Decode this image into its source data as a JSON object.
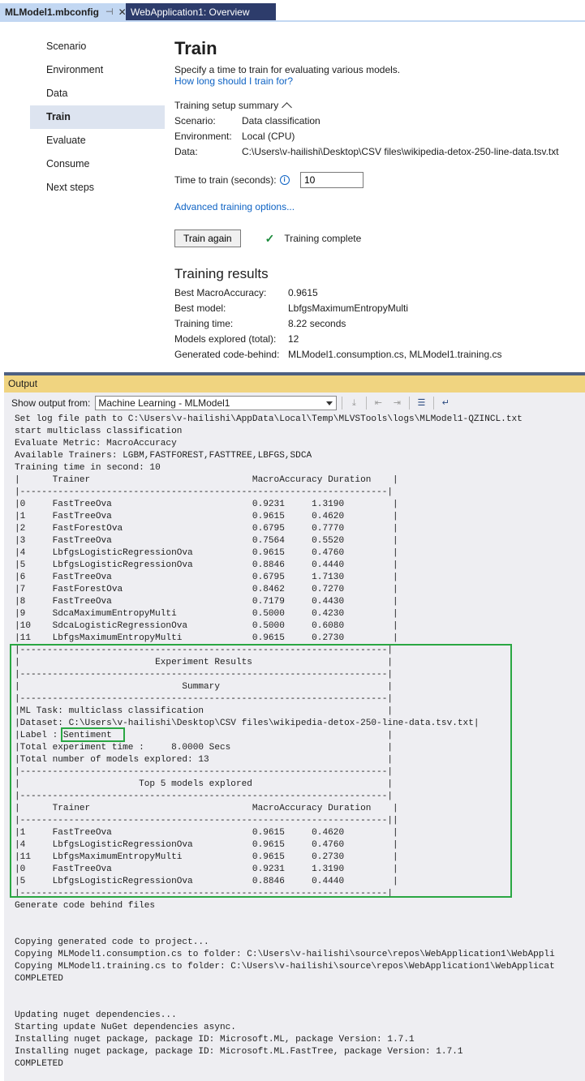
{
  "tabs": {
    "active_label": "MLModel1.mbconfig",
    "active_pin": "⊣",
    "active_close": "✕",
    "inactive_label": "WebApplication1: Overview"
  },
  "nav": {
    "items": [
      "Scenario",
      "Environment",
      "Data",
      "Train",
      "Evaluate",
      "Consume",
      "Next steps"
    ],
    "active": "Train"
  },
  "train": {
    "title": "Train",
    "description": "Specify a time to train for evaluating various models.",
    "help_link": "How long should I train for?",
    "summary_toggle": "Training setup summary",
    "summary": [
      {
        "key": "Scenario:",
        "value": "Data classification"
      },
      {
        "key": "Environment:",
        "value": "Local (CPU)"
      },
      {
        "key": "Data:",
        "value": "C:\\Users\\v-hailishi\\Desktop\\CSV files\\wikipedia-detox-250-line-data.tsv.txt"
      }
    ],
    "time_label": "Time to train (seconds):",
    "time_value": "10",
    "advanced_link": "Advanced training options...",
    "train_button": "Train again",
    "status": "Training complete"
  },
  "results": {
    "title": "Training results",
    "rows": [
      {
        "key": "Best MacroAccuracy:",
        "value": "0.9615"
      },
      {
        "key": "Best model:",
        "value": "LbfgsMaximumEntropyMulti"
      },
      {
        "key": "Training time:",
        "value": "8.22 seconds"
      },
      {
        "key": "Models explored (total):",
        "value": "12"
      },
      {
        "key": "Generated code-behind:",
        "value": "MLModel1.consumption.cs, MLModel1.training.cs"
      }
    ]
  },
  "output": {
    "header": "Output",
    "show_from_label": "Show output from:",
    "source": "Machine Learning - MLModel1",
    "log": [
      "Set log file path to C:\\Users\\v-hailishi\\AppData\\Local\\Temp\\MLVSTools\\logs\\MLModel1-QZINCL.txt",
      "start multiclass classification",
      "Evaluate Metric: MacroAccuracy",
      "Available Trainers: LGBM,FASTFOREST,FASTTREE,LBFGS,SDCA",
      "Training time in second: 10",
      "|      Trainer                              MacroAccuracy Duration    |",
      "|--------------------------------------------------------------------|",
      "|0     FastTreeOva                          0.9231     1.3190         |",
      "|1     FastTreeOva                          0.9615     0.4620         |",
      "|2     FastForestOva                        0.6795     0.7770         |",
      "|3     FastTreeOva                          0.7564     0.5520         |",
      "|4     LbfgsLogisticRegressionOva           0.9615     0.4760         |",
      "|5     LbfgsLogisticRegressionOva           0.8846     0.4440         |",
      "|6     FastTreeOva                          0.6795     1.7130         |",
      "|7     FastForestOva                        0.8462     0.7270         |",
      "|8     FastTreeOva                          0.7179     0.4430         |",
      "|9     SdcaMaximumEntropyMulti              0.5000     0.4230         |",
      "|10    SdcaLogisticRegressionOva            0.5000     0.6080         |",
      "|11    LbfgsMaximumEntropyMulti             0.9615     0.2730         |",
      "|--------------------------------------------------------------------|",
      "|                         Experiment Results                         |",
      "|--------------------------------------------------------------------|",
      "|                              Summary                               |",
      "|--------------------------------------------------------------------|",
      "|ML Task: multiclass classification                                  |",
      "|Dataset: C:\\Users\\v-hailishi\\Desktop\\CSV files\\wikipedia-detox-250-line-data.tsv.txt|",
      "|Label : Sentiment                                                   |",
      "|Total experiment time :     8.0000 Secs                             |",
      "|Total number of models explored: 13                                 |",
      "|--------------------------------------------------------------------|",
      "|                      Top 5 models explored                         |",
      "|--------------------------------------------------------------------|",
      "|      Trainer                              MacroAccuracy Duration    |",
      "|--------------------------------------------------------------------||",
      "|1     FastTreeOva                          0.9615     0.4620         |",
      "|4     LbfgsLogisticRegressionOva           0.9615     0.4760         |",
      "|11    LbfgsMaximumEntropyMulti             0.9615     0.2730         |",
      "|0     FastTreeOva                          0.9231     1.3190         |",
      "|5     LbfgsLogisticRegressionOva           0.8846     0.4440         |",
      "|--------------------------------------------------------------------|",
      "Generate code behind files",
      "",
      "",
      "Copying generated code to project...",
      "Copying MLModel1.consumption.cs to folder: C:\\Users\\v-hailishi\\source\\repos\\WebApplication1\\WebAppli",
      "Copying MLModel1.training.cs to folder: C:\\Users\\v-hailishi\\source\\repos\\WebApplication1\\WebApplicat",
      "COMPLETED",
      "",
      "",
      "Updating nuget dependencies...",
      "Starting update NuGet dependencies async.",
      "Installing nuget package, package ID: Microsoft.ML, package Version: 1.7.1",
      "Installing nuget package, package ID: Microsoft.ML.FastTree, package Version: 1.7.1",
      "COMPLETED"
    ]
  }
}
